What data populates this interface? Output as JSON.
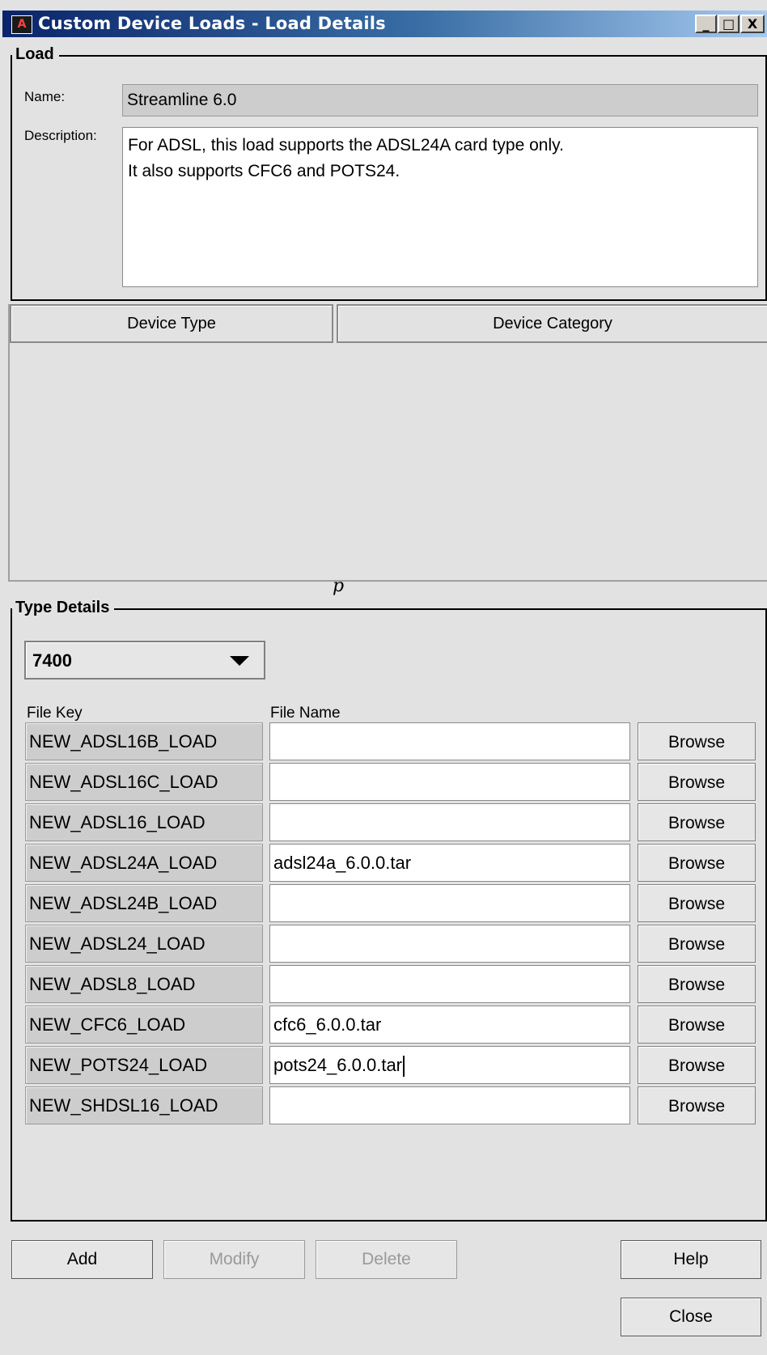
{
  "window": {
    "title": "Custom Device Loads - Load Details",
    "controls": {
      "minimize": "_",
      "maximize": "□",
      "close": "X"
    }
  },
  "load": {
    "group_title": "Load",
    "name_label": "Name:",
    "name_value": "Streamline 6.0",
    "description_label": "Description:",
    "description_value": "For ADSL, this load supports the ADSL24A card type only.\nIt also supports CFC6 and POTS24."
  },
  "device_table": {
    "columns": [
      "Device Type",
      "Device Category"
    ],
    "rows": []
  },
  "splitter_glyph": "p",
  "type_details": {
    "group_title": "Type Details",
    "type_select_value": "7400",
    "file_key_header": "File Key",
    "file_name_header": "File Name",
    "browse_label": "Browse",
    "rows": [
      {
        "key": "NEW_ADSL16B_LOAD",
        "file": ""
      },
      {
        "key": "NEW_ADSL16C_LOAD",
        "file": ""
      },
      {
        "key": "NEW_ADSL16_LOAD",
        "file": ""
      },
      {
        "key": "NEW_ADSL24A_LOAD",
        "file": "adsl24a_6.0.0.tar"
      },
      {
        "key": "NEW_ADSL24B_LOAD",
        "file": ""
      },
      {
        "key": "NEW_ADSL24_LOAD",
        "file": ""
      },
      {
        "key": "NEW_ADSL8_LOAD",
        "file": ""
      },
      {
        "key": "NEW_CFC6_LOAD",
        "file": "cfc6_6.0.0.tar"
      },
      {
        "key": "NEW_POTS24_LOAD",
        "file": "pots24_6.0.0.tar"
      },
      {
        "key": "NEW_SHDSL16_LOAD",
        "file": ""
      }
    ]
  },
  "buttons": {
    "add": "Add",
    "modify": "Modify",
    "delete": "Delete",
    "help": "Help",
    "close": "Close"
  }
}
